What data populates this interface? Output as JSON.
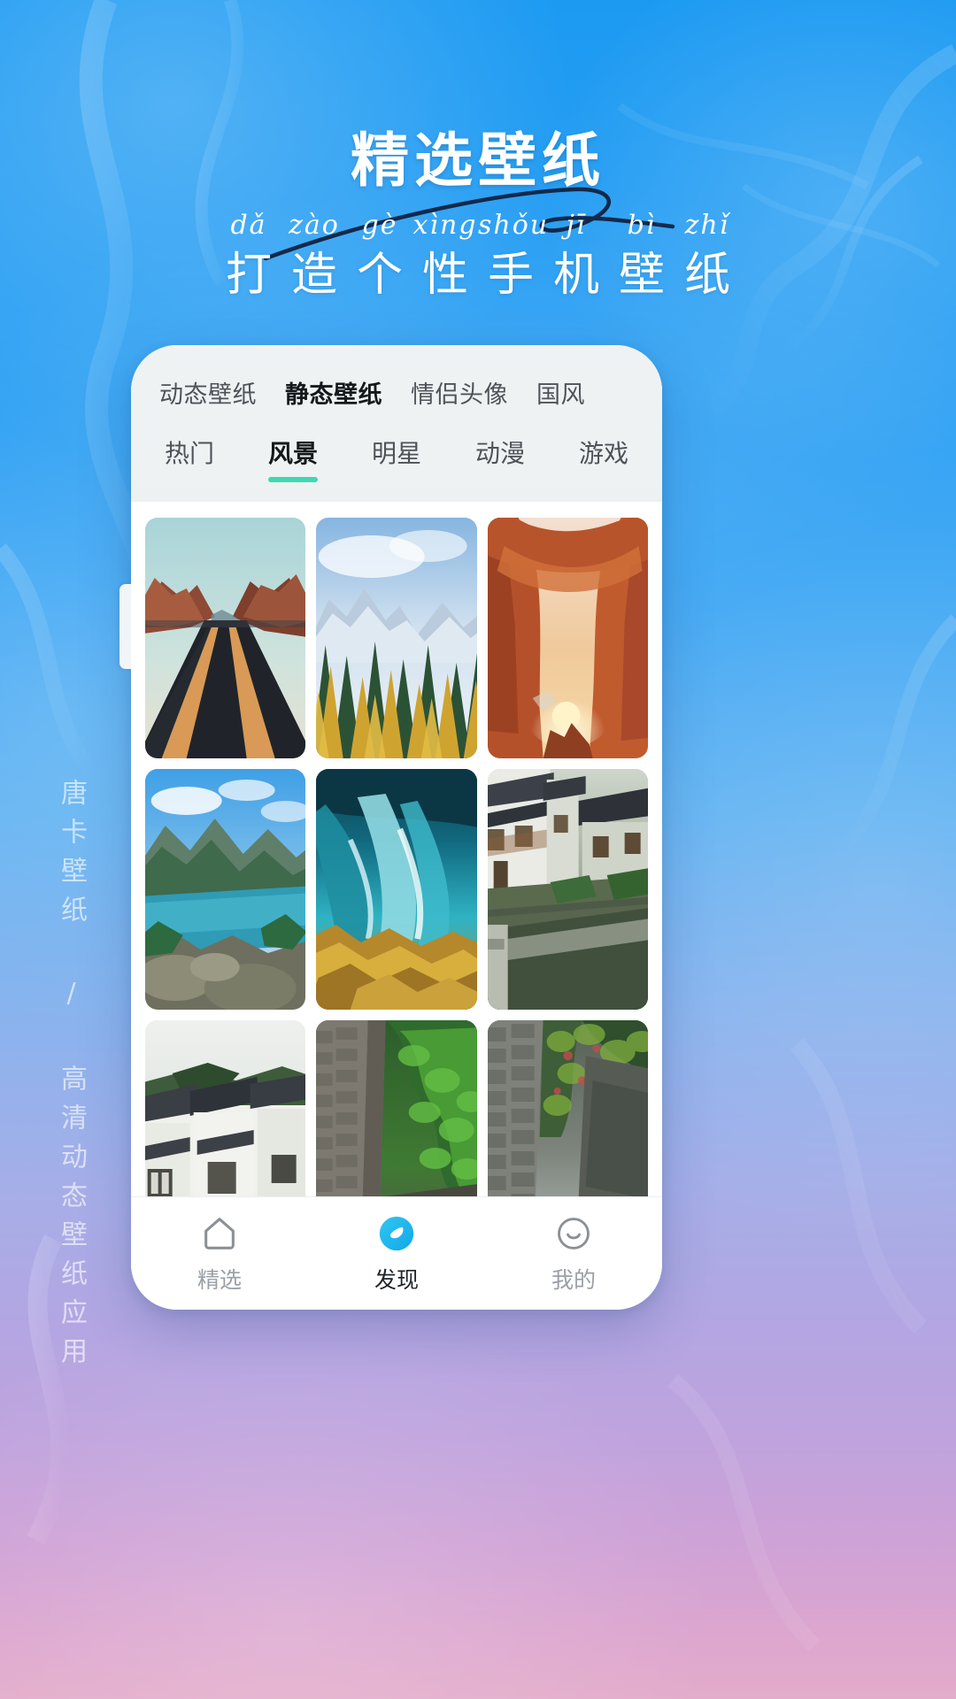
{
  "background": {
    "top_color": "#1c9af2",
    "bottom_color": "#e3accb"
  },
  "header": {
    "title": "精选壁纸",
    "pinyin": [
      "dǎ",
      "zào",
      "gè",
      "xìng",
      "shǒu",
      "jī",
      "bì",
      "zhǐ"
    ],
    "subtitle_chars": [
      "打",
      "造",
      "个",
      "性",
      "手",
      "机",
      "壁",
      "纸"
    ],
    "subtitle": "打造个性手机壁纸"
  },
  "side_text": "唐卡壁纸 / 高清动态壁纸应用",
  "app": {
    "main_tabs": [
      {
        "label": "动态壁纸",
        "active": false
      },
      {
        "label": "静态壁纸",
        "active": true
      },
      {
        "label": "情侣头像",
        "active": false
      },
      {
        "label": "国风",
        "active": false
      }
    ],
    "sub_tabs": [
      {
        "label": "热门",
        "active": false
      },
      {
        "label": "风景",
        "active": true
      },
      {
        "label": "明星",
        "active": false
      },
      {
        "label": "动漫",
        "active": false
      },
      {
        "label": "游戏",
        "active": false
      }
    ],
    "active_indicator_color": "#3fd8b4",
    "wallpapers": [
      {
        "name": "desert-road",
        "alt": "沙漠公路"
      },
      {
        "name": "snow-mountain-forest",
        "alt": "雪山森林"
      },
      {
        "name": "red-canyon-arch",
        "alt": "红岩拱门"
      },
      {
        "name": "alpine-lake",
        "alt": "高山湖泊"
      },
      {
        "name": "turquoise-waterfall",
        "alt": "碧蓝瀑布"
      },
      {
        "name": "water-town-canal",
        "alt": "江南水乡"
      },
      {
        "name": "ancient-village",
        "alt": "徽派古村"
      },
      {
        "name": "stone-alley-green",
        "alt": "石巷绿意"
      },
      {
        "name": "stone-path-wall",
        "alt": "青石小径"
      }
    ],
    "bottom_nav": [
      {
        "label": "精选",
        "icon": "home-icon",
        "active": false
      },
      {
        "label": "发现",
        "icon": "discover-icon",
        "active": true
      },
      {
        "label": "我的",
        "icon": "smiley-icon",
        "active": false
      }
    ],
    "nav_active_color": "#29bdf0"
  }
}
